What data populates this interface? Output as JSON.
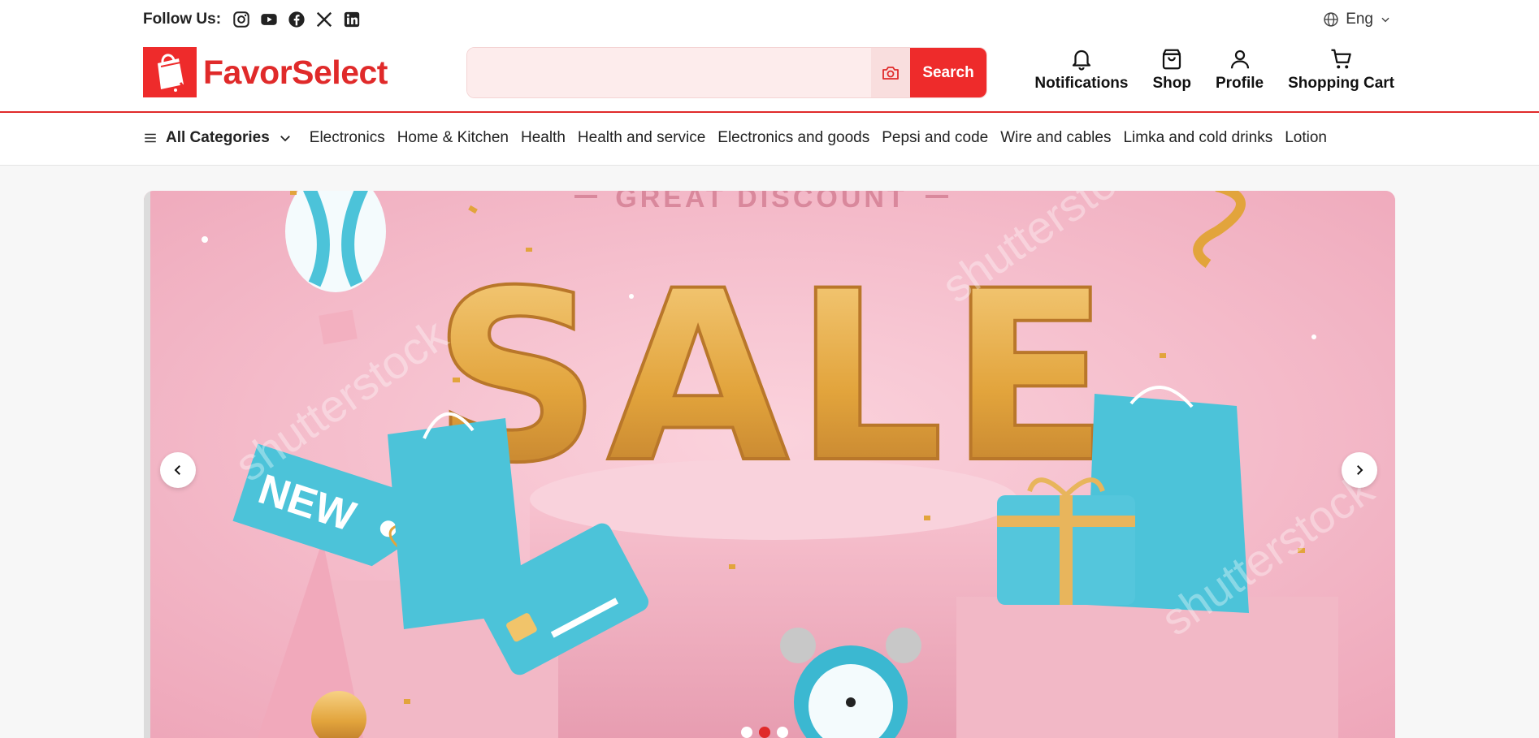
{
  "topbar": {
    "follow_label": "Follow Us:",
    "social": [
      "instagram-icon",
      "youtube-icon",
      "facebook-icon",
      "x-icon",
      "linkedin-icon"
    ],
    "language": "Eng"
  },
  "header": {
    "brand": "FavorSelect",
    "search_placeholder": "",
    "search_button": "Search",
    "actions": [
      {
        "label": "Notifications",
        "icon": "bell-icon"
      },
      {
        "label": "Shop",
        "icon": "shopping-bag-icon"
      },
      {
        "label": "Profile",
        "icon": "user-icon"
      },
      {
        "label": "Shopping Cart",
        "icon": "cart-icon"
      }
    ]
  },
  "categories": {
    "all_label": "All Categories",
    "items": [
      "Electronics",
      "Home & Kitchen",
      "Health",
      "Health and service",
      "Electronics and goods",
      "Pepsi and code",
      "Wire and cables",
      "Limka and cold drinks",
      "Lotion"
    ]
  },
  "banner": {
    "headline": "GREAT DISCOUNT",
    "main_word": "SALE",
    "tag_text": "NEW",
    "watermark": "shutterstock",
    "slide_count": 3,
    "active_slide": 2
  },
  "colors": {
    "brand": "#e02a2a",
    "banner_bg": "#f3b6c6",
    "gold": "#e2a43c",
    "teal": "#4cc3d9"
  }
}
